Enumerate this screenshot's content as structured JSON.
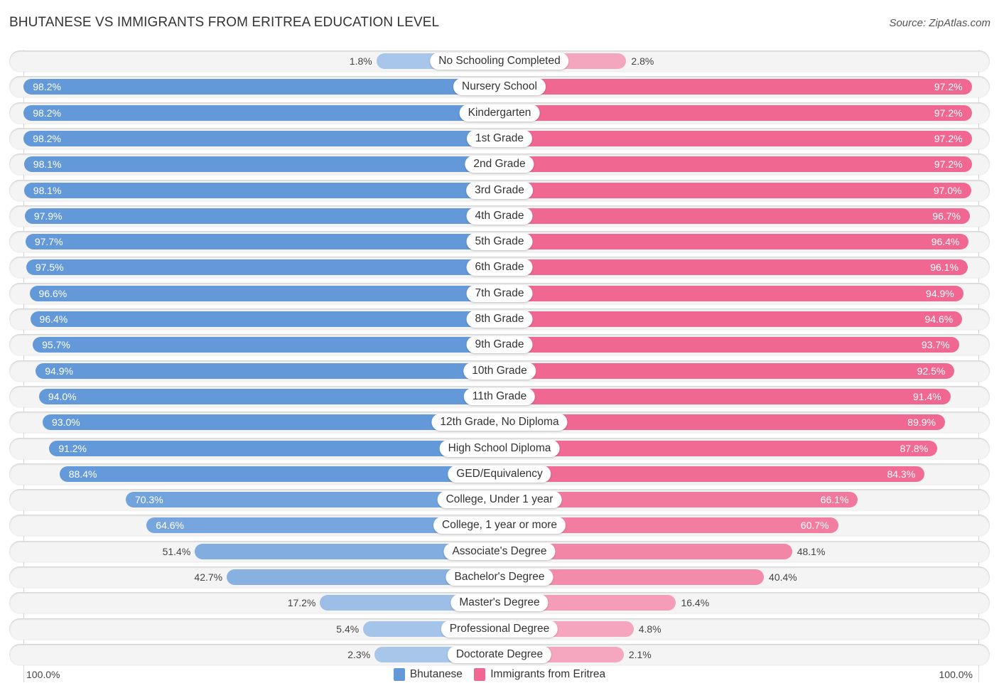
{
  "header": {
    "title": "BHUTANESE VS IMMIGRANTS FROM ERITREA EDUCATION LEVEL",
    "source": "Source: ZipAtlas.com"
  },
  "axis": {
    "left_label": "100.0%",
    "right_label": "100.0%"
  },
  "legend": [
    {
      "name": "Bhutanese",
      "color": "#6399d9"
    },
    {
      "name": "Immigrants from Eritrea",
      "color": "#f06892"
    }
  ],
  "colors": {
    "left_strong": "#6399d9",
    "left_light": "#a9c7ea",
    "right_strong": "#f06892",
    "right_light": "#f5a8c0"
  },
  "chart_data": {
    "type": "bar",
    "orientation": "horizontal-diverging",
    "title": "BHUTANESE VS IMMIGRANTS FROM ERITREA EDUCATION LEVEL",
    "xlabel": "",
    "ylabel": "",
    "xlim": [
      0,
      100
    ],
    "legend_position": "bottom-center",
    "categories": [
      "No Schooling Completed",
      "Nursery School",
      "Kindergarten",
      "1st Grade",
      "2nd Grade",
      "3rd Grade",
      "4th Grade",
      "5th Grade",
      "6th Grade",
      "7th Grade",
      "8th Grade",
      "9th Grade",
      "10th Grade",
      "11th Grade",
      "12th Grade, No Diploma",
      "High School Diploma",
      "GED/Equivalency",
      "College, Under 1 year",
      "College, 1 year or more",
      "Associate's Degree",
      "Bachelor's Degree",
      "Master's Degree",
      "Professional Degree",
      "Doctorate Degree"
    ],
    "series": [
      {
        "name": "Bhutanese",
        "side": "left",
        "values": [
          1.8,
          98.2,
          98.2,
          98.2,
          98.1,
          98.1,
          97.9,
          97.7,
          97.5,
          96.6,
          96.4,
          95.7,
          94.9,
          94.0,
          93.0,
          91.2,
          88.4,
          70.3,
          64.6,
          51.4,
          42.7,
          17.2,
          5.4,
          2.3
        ],
        "labels": [
          "1.8%",
          "98.2%",
          "98.2%",
          "98.2%",
          "98.1%",
          "98.1%",
          "97.9%",
          "97.7%",
          "97.5%",
          "96.6%",
          "96.4%",
          "95.7%",
          "94.9%",
          "94.0%",
          "93.0%",
          "91.2%",
          "88.4%",
          "70.3%",
          "64.6%",
          "51.4%",
          "42.7%",
          "17.2%",
          "5.4%",
          "2.3%"
        ]
      },
      {
        "name": "Immigrants from Eritrea",
        "side": "right",
        "values": [
          2.8,
          97.2,
          97.2,
          97.2,
          97.2,
          97.0,
          96.7,
          96.4,
          96.1,
          94.9,
          94.6,
          93.7,
          92.5,
          91.4,
          89.9,
          87.8,
          84.3,
          66.1,
          60.7,
          48.1,
          40.4,
          16.4,
          4.8,
          2.1
        ],
        "labels": [
          "2.8%",
          "97.2%",
          "97.2%",
          "97.2%",
          "97.2%",
          "97.0%",
          "96.7%",
          "96.4%",
          "96.1%",
          "94.9%",
          "94.6%",
          "93.7%",
          "92.5%",
          "91.4%",
          "89.9%",
          "87.8%",
          "84.3%",
          "66.1%",
          "60.7%",
          "48.1%",
          "40.4%",
          "16.4%",
          "4.8%",
          "2.1%"
        ]
      }
    ]
  }
}
